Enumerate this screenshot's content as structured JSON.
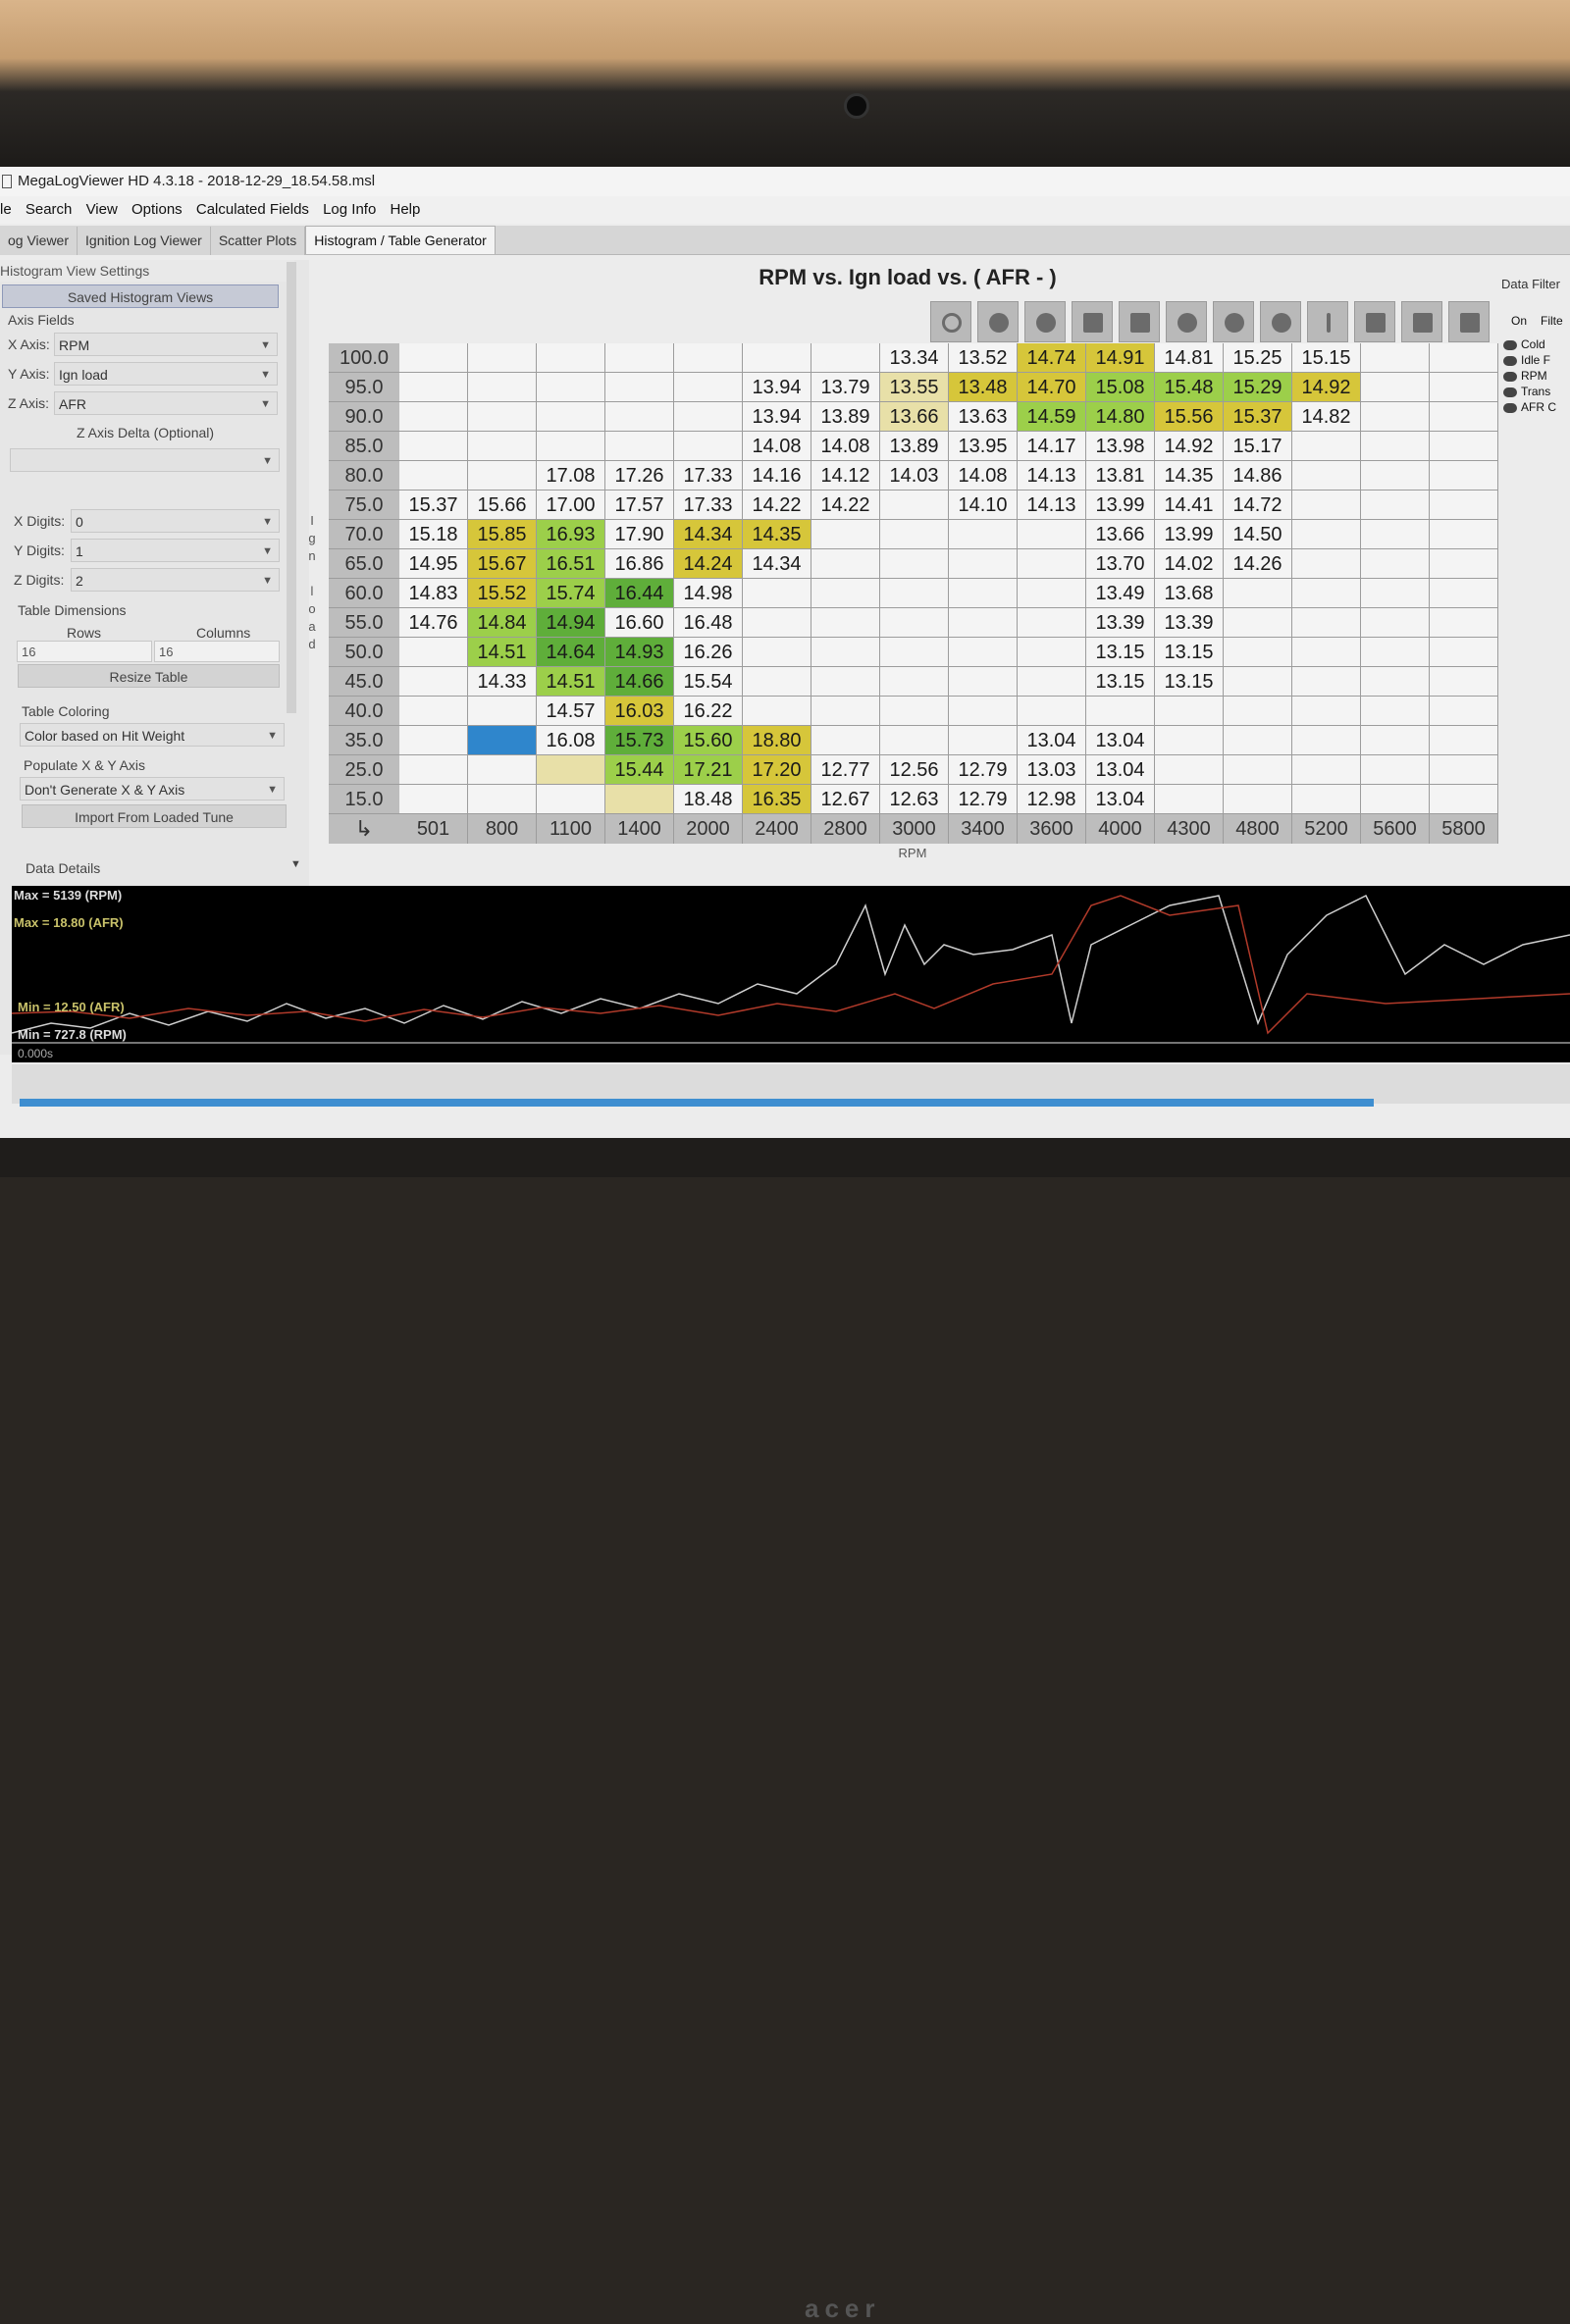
{
  "window": {
    "title": "MegaLogViewer HD 4.3.18 - 2018-12-29_18.54.58.msl"
  },
  "menu": [
    "le",
    "Search",
    "View",
    "Options",
    "Calculated Fields",
    "Log Info",
    "Help"
  ],
  "tabs": [
    "og Viewer",
    "Ignition Log Viewer",
    "Scatter Plots",
    "Histogram / Table Generator"
  ],
  "settings": {
    "header": "Histogram View Settings",
    "saved_views": "Saved Histogram Views",
    "axis_fields": "Axis Fields",
    "x_axis_label": "X Axis:",
    "x_axis_value": "RPM",
    "y_axis_label": "Y Axis:",
    "y_axis_value": "Ign load",
    "z_axis_label": "Z Axis:",
    "z_axis_value": "AFR",
    "z_delta_label": "Z Axis Delta (Optional)",
    "x_digits_label": "X Digits:",
    "x_digits_value": "0",
    "y_digits_label": "Y Digits:",
    "y_digits_value": "1",
    "z_digits_label": "Z Digits:",
    "z_digits_value": "2",
    "table_dimensions": "Table Dimensions",
    "rows_label": "Rows",
    "columns_label": "Columns",
    "rows_value": "16",
    "columns_value": "16",
    "resize_button": "Resize Table",
    "table_coloring": "Table Coloring",
    "coloring_value": "Color based on Hit Weight",
    "populate_label": "Populate X & Y Axis",
    "populate_value": "Don't Generate X & Y Axis",
    "import_button": "Import From Loaded Tune",
    "data_details": "Data Details"
  },
  "chart": {
    "title": "RPM vs. Ign load vs. ( AFR -   )",
    "y_axis_title": "Ign load",
    "x_axis_title": "RPM",
    "corner_symbol": "↳"
  },
  "table": {
    "x_axis": [
      "501",
      "800",
      "1100",
      "1400",
      "2000",
      "2400",
      "2800",
      "3000",
      "3400",
      "3600",
      "4000",
      "4300",
      "4800",
      "5200",
      "5600",
      "5800"
    ],
    "rows": [
      {
        "y": "100.0",
        "cells": [
          "",
          "",
          "",
          "",
          "",
          "",
          "",
          "13.34",
          "13.52",
          "14.74",
          "14.91",
          "14.81",
          "15.25",
          "15.15",
          "",
          ""
        ]
      },
      {
        "y": "95.0",
        "cells": [
          "",
          "",
          "",
          "",
          "",
          "13.94",
          "13.79",
          "13.55",
          "13.48",
          "14.70",
          "15.08",
          "15.48",
          "15.29",
          "14.92",
          "",
          ""
        ]
      },
      {
        "y": "90.0",
        "cells": [
          "",
          "",
          "",
          "",
          "",
          "13.94",
          "13.89",
          "13.66",
          "13.63",
          "14.59",
          "14.80",
          "15.56",
          "15.37",
          "14.82",
          "",
          ""
        ]
      },
      {
        "y": "85.0",
        "cells": [
          "",
          "",
          "",
          "",
          "",
          "14.08",
          "14.08",
          "13.89",
          "13.95",
          "14.17",
          "13.98",
          "14.92",
          "15.17",
          "",
          "",
          ""
        ]
      },
      {
        "y": "80.0",
        "cells": [
          "",
          "",
          "17.08",
          "17.26",
          "17.33",
          "14.16",
          "14.12",
          "14.03",
          "14.08",
          "14.13",
          "13.81",
          "14.35",
          "14.86",
          "",
          "",
          ""
        ]
      },
      {
        "y": "75.0",
        "cells": [
          "15.37",
          "15.66",
          "17.00",
          "17.57",
          "17.33",
          "14.22",
          "14.22",
          "",
          "14.10",
          "14.13",
          "13.99",
          "14.41",
          "14.72",
          "",
          "",
          ""
        ]
      },
      {
        "y": "70.0",
        "cells": [
          "15.18",
          "15.85",
          "16.93",
          "17.90",
          "14.34",
          "14.35",
          "",
          "",
          "",
          "",
          "13.66",
          "13.99",
          "14.50",
          "",
          "",
          ""
        ]
      },
      {
        "y": "65.0",
        "cells": [
          "14.95",
          "15.67",
          "16.51",
          "16.86",
          "14.24",
          "14.34",
          "",
          "",
          "",
          "",
          "13.70",
          "14.02",
          "14.26",
          "",
          "",
          ""
        ]
      },
      {
        "y": "60.0",
        "cells": [
          "14.83",
          "15.52",
          "15.74",
          "16.44",
          "14.98",
          "",
          "",
          "",
          "",
          "",
          "13.49",
          "13.68",
          "",
          "",
          "",
          ""
        ]
      },
      {
        "y": "55.0",
        "cells": [
          "14.76",
          "14.84",
          "14.94",
          "16.60",
          "16.48",
          "",
          "",
          "",
          "",
          "",
          "13.39",
          "13.39",
          "",
          "",
          "",
          ""
        ]
      },
      {
        "y": "50.0",
        "cells": [
          "",
          "14.51",
          "14.64",
          "14.93",
          "16.26",
          "",
          "",
          "",
          "",
          "",
          "13.15",
          "13.15",
          "",
          "",
          "",
          ""
        ]
      },
      {
        "y": "45.0",
        "cells": [
          "",
          "14.33",
          "14.51",
          "14.66",
          "15.54",
          "",
          "",
          "",
          "",
          "",
          "13.15",
          "13.15",
          "",
          "",
          "",
          ""
        ]
      },
      {
        "y": "40.0",
        "cells": [
          "",
          "",
          "14.57",
          "16.03",
          "16.22",
          "",
          "",
          "",
          "",
          "",
          "",
          "",
          "",
          "",
          "",
          ""
        ]
      },
      {
        "y": "35.0",
        "cells": [
          "",
          "",
          "16.08",
          "15.73",
          "15.60",
          "18.80",
          "",
          "",
          "",
          "13.04",
          "13.04",
          "",
          "",
          "",
          "",
          ""
        ]
      },
      {
        "y": "25.0",
        "cells": [
          "",
          "",
          "",
          "15.44",
          "17.21",
          "17.20",
          "12.77",
          "12.56",
          "12.79",
          "13.03",
          "13.04",
          "",
          "",
          "",
          "",
          ""
        ]
      },
      {
        "y": "15.0",
        "cells": [
          "",
          "",
          "",
          "",
          "18.48",
          "16.35",
          "12.67",
          "12.63",
          "12.79",
          "12.98",
          "13.04",
          "",
          "",
          "",
          "",
          ""
        ]
      }
    ],
    "colors": {
      "yellow": [
        "0-9",
        "0-10",
        "1-8",
        "1-9",
        "1-13",
        "2-11",
        "2-12",
        "6-1",
        "6-4",
        "6-5",
        "7-1",
        "7-4",
        "8-1",
        "13-5",
        "14-5",
        "15-5",
        "12-3"
      ],
      "lightgreen": [
        "1-10",
        "1-11",
        "1-12",
        "2-9",
        "2-10",
        "6-2",
        "7-2",
        "8-2",
        "9-1",
        "10-1",
        "11-2",
        "13-4",
        "14-3",
        "14-4"
      ],
      "midgreen": [
        "8-3",
        "9-2",
        "10-3",
        "10-2",
        "11-3",
        "13-3"
      ],
      "darkgreen": [
        "9-2b"
      ],
      "pale": [
        "1-7",
        "2-7",
        "13-1",
        "14-2",
        "15-3"
      ],
      "blue": [
        "13-1"
      ]
    }
  },
  "data_filter": {
    "title": "Data Filter",
    "col_on": "On",
    "col_filter": "Filte",
    "items": [
      "Cold",
      "Idle F",
      "RPM",
      "Trans",
      "AFR C"
    ]
  },
  "log_stats": {
    "max_rpm": "Max = 5139 (RPM)",
    "max_afr": "Max = 18.80 (AFR)",
    "min_afr": "Min = 12.50 (AFR)",
    "min_rpm": "Min = 727.8 (RPM)",
    "time": "0.000s"
  },
  "palette": {
    "yellow": "#d6c63a",
    "lightgreen": "#9ccf4a",
    "midgreen": "#5fae3a",
    "darkgreen": "#3b8e2c",
    "pale": "#e8e0a8",
    "blue": "#2f86cc"
  }
}
